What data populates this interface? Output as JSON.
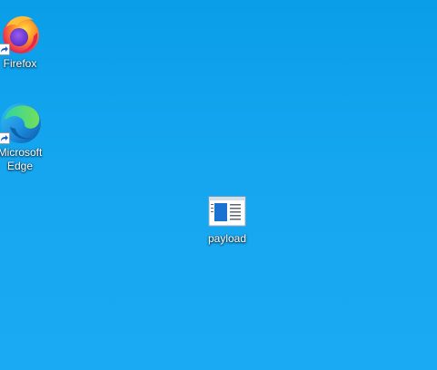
{
  "desktop": {
    "background_color": "#14a3ee",
    "icons": [
      {
        "label": "Firefox",
        "icon": "firefox-icon",
        "shortcut": true
      },
      {
        "label": "Microsoft\nEdge",
        "icon": "edge-icon",
        "shortcut": true
      },
      {
        "label": "payload",
        "icon": "application-window-icon",
        "shortcut": false
      }
    ]
  }
}
